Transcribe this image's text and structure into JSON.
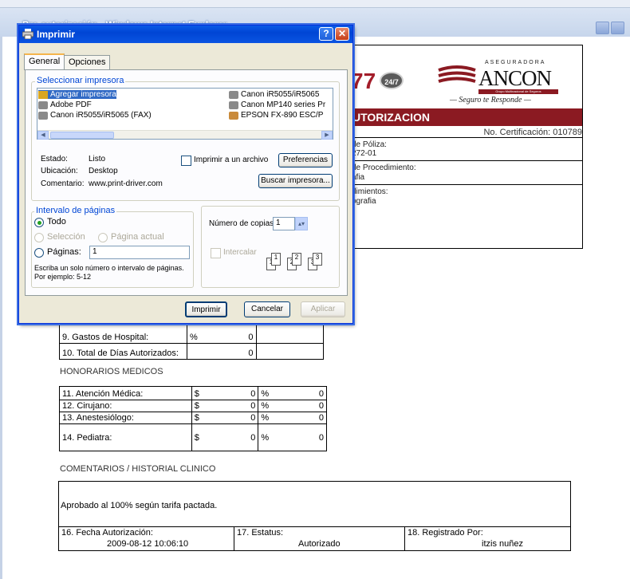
{
  "browser": {
    "title": "Pre-autorización - Windows Internet Explorer"
  },
  "document": {
    "logo_number": "77",
    "logo_badge": "24/7",
    "brand": {
      "tagline_top": "ASEGURADORA",
      "name": "ANCON",
      "stripe_text": "Grupo Multinacional de Seguros",
      "slogan": "— Seguro te Responde —"
    },
    "header_title": "UTORIZACION",
    "certification": "No. Certificación: 010789",
    "rows": [
      {
        "label": "de Póliza:",
        "value": "272-01"
      },
      {
        "label": "de Procedimiento:",
        "value": "afia"
      },
      {
        "label": "dimientos:",
        "value": "ografia"
      }
    ],
    "gastos": [
      {
        "label": "9. Gastos de Hospital:",
        "unit": "%",
        "value": "0"
      },
      {
        "label": "10. Total de Días Autorizados:",
        "unit": "",
        "value": "0"
      }
    ],
    "honorarios_title": "HONORARIOS MEDICOS",
    "honorarios": [
      {
        "label": "11. Atención Médica:",
        "unit1": "$",
        "val1": "0",
        "unit2": "%",
        "val2": "0"
      },
      {
        "label": "12. Cirujano:",
        "unit1": "$",
        "val1": "0",
        "unit2": "%",
        "val2": "0"
      },
      {
        "label": "13. Anestesiólogo:",
        "unit1": "$",
        "val1": "0",
        "unit2": "%",
        "val2": "0"
      },
      {
        "label": "14. Pediatra:",
        "unit1": "$",
        "val1": "0",
        "unit2": "%",
        "val2": "0"
      }
    ],
    "comentarios_title": "COMENTARIOS / HISTORIAL CLINICO",
    "comentario": "Aprobado al 100% según tarifa pactada.",
    "footer": {
      "fecha_label": "16. Fecha Autorización:",
      "fecha_value": "2009-08-12 10:06:10",
      "estatus_label": "17. Estatus:",
      "estatus_value": "Autorizado",
      "registrado_label": "18. Registrado Por:",
      "registrado_value": "itzis nuñez"
    }
  },
  "dialog": {
    "title": "Imprimir",
    "help_button": "?",
    "close_button": "✕",
    "tabs": [
      "General",
      "Opciones"
    ],
    "printer_group_title": "Seleccionar impresora",
    "printers_left": [
      "Agregar impresora",
      "Adobe PDF",
      "Canon iR5055/iR5065 (FAX)"
    ],
    "printers_right": [
      "Canon iR5055/iR5065",
      "Canon MP140 series Pr",
      "EPSON FX-890 ESC/P"
    ],
    "status_label": "Estado:",
    "status_value": "Listo",
    "location_label": "Ubicación:",
    "location_value": "Desktop",
    "comment_label": "Comentario:",
    "comment_value": "www.print-driver.com",
    "print_to_file": "Imprimir a un archivo",
    "preferences_button": "Preferencias",
    "find_printer_button": "Buscar impresora...",
    "range_group_title": "Intervalo de páginas",
    "range_all": "Todo",
    "range_selection": "Selección",
    "range_current": "Página actual",
    "range_pages": "Páginas:",
    "pages_value": "1",
    "range_hint": "Escriba un solo número o intervalo de páginas. Por ejemplo: 5-12",
    "copies_label": "Número de copias:",
    "copies_value": "1",
    "collate_label": "Intercalar",
    "collate_pages": [
      "1",
      "1",
      "2",
      "2",
      "3",
      "3"
    ],
    "print_button": "Imprimir",
    "cancel_button": "Cancelar",
    "apply_button": "Aplicar"
  }
}
